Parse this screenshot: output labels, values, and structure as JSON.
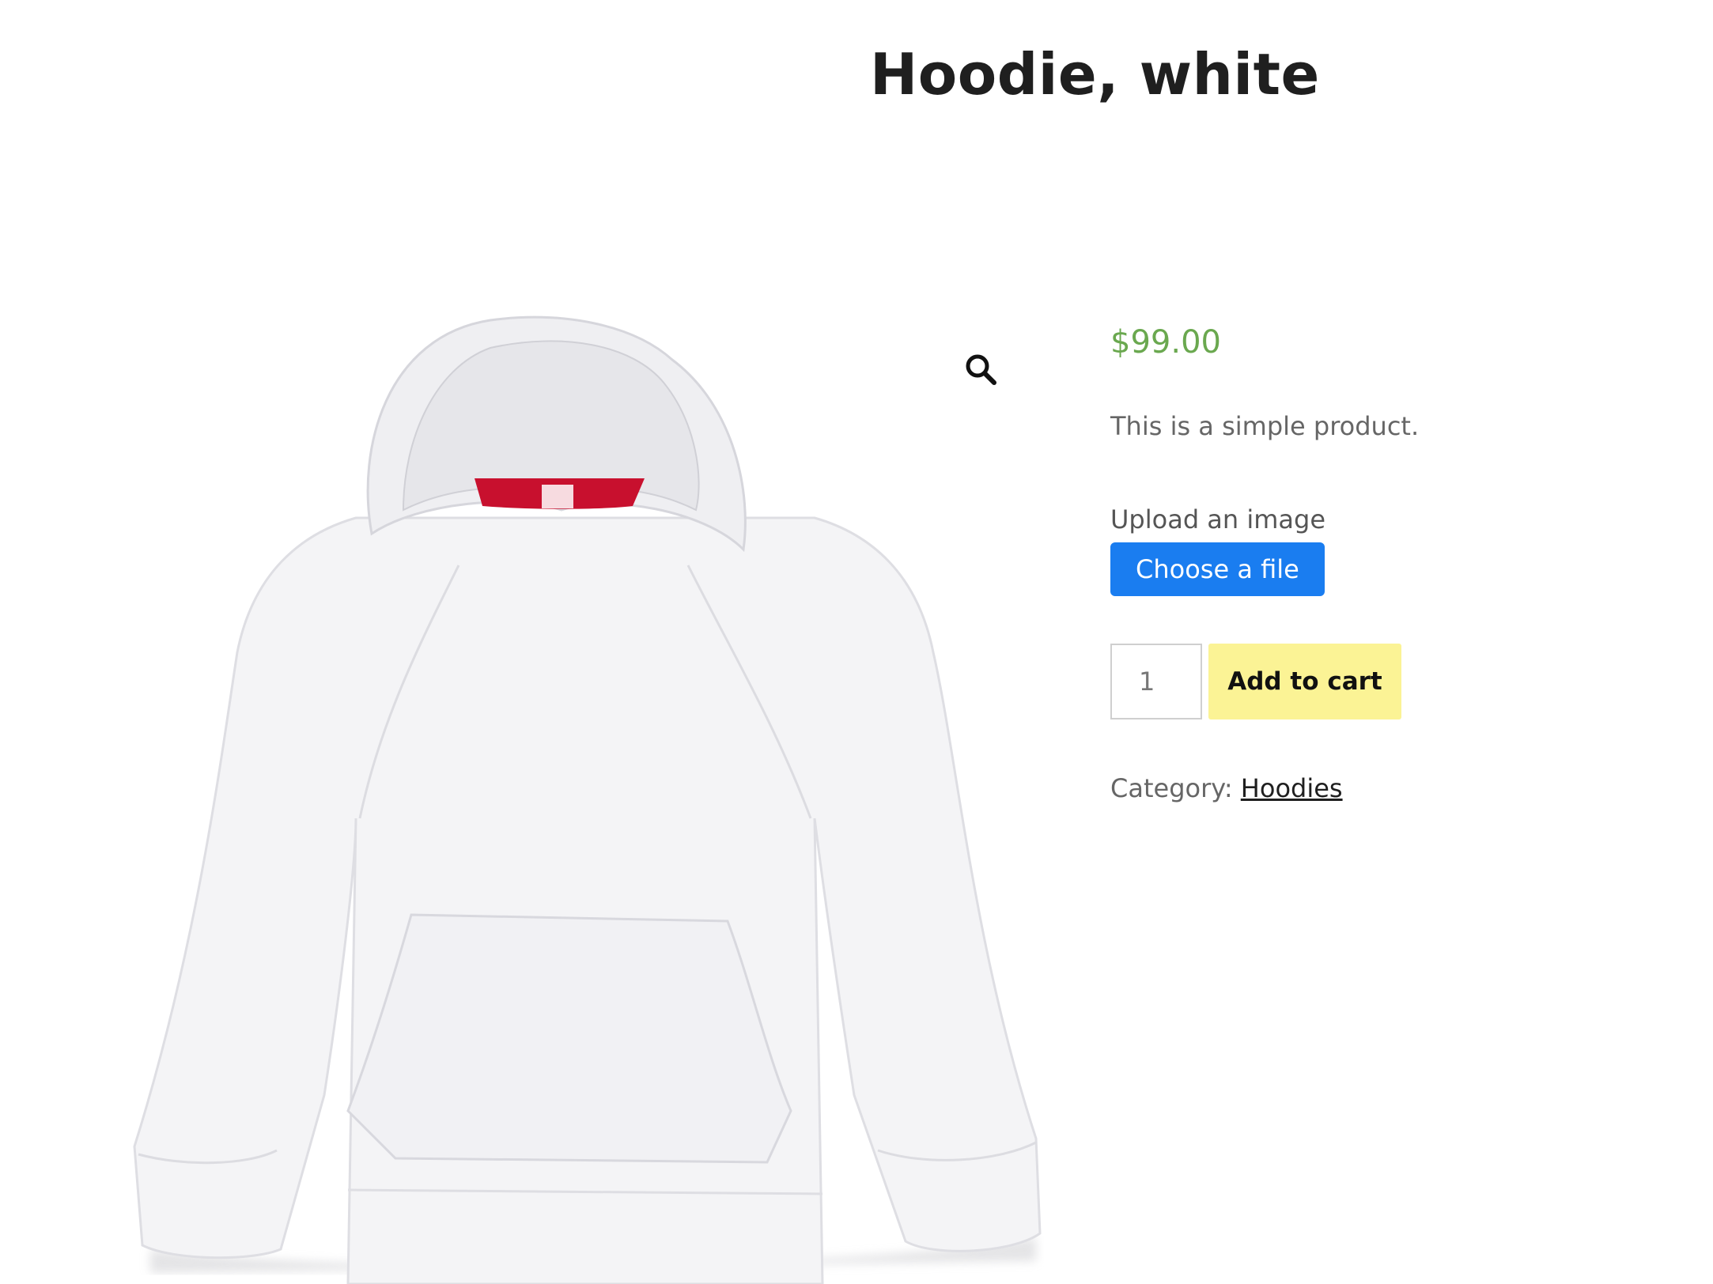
{
  "product": {
    "title": "Hoodie, white",
    "price": "$99.00",
    "short_description": "This is a simple product.",
    "image_alt": "White hoodie with red-lined hood"
  },
  "gallery": {
    "zoom_icon": "magnifier-icon"
  },
  "upload": {
    "label": "Upload an image",
    "button_label": "Choose a file"
  },
  "cart": {
    "quantity": "1",
    "add_to_cart_label": "Add to cart"
  },
  "meta": {
    "category_label": "Category:",
    "category_link": "Hoodies"
  },
  "colors": {
    "price": "#6aa84f",
    "upload_button": "#1a7df0",
    "add_to_cart_button": "#fbf395",
    "hood_lining": "#c8102e"
  }
}
